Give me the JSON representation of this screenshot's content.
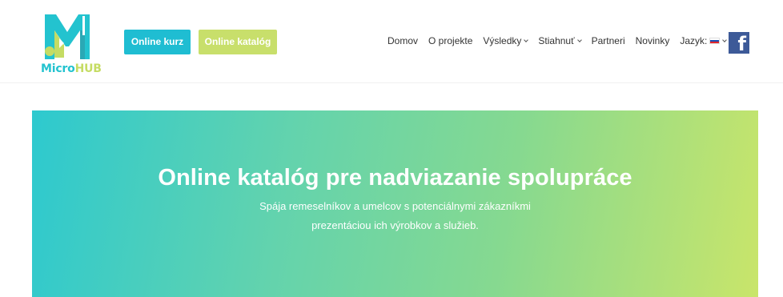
{
  "brand": {
    "logo_micro": "Micro",
    "logo_hub": "HUB",
    "colors": {
      "teal": "#1fbdd2",
      "lime": "#c8df6b",
      "facebook": "#3d5a98"
    }
  },
  "header": {
    "buttons": {
      "online_kurz": "Online kurz",
      "online_katalog": "Online katalóg"
    },
    "nav": [
      {
        "label": "Domov"
      },
      {
        "label": "O projekte"
      },
      {
        "label": "Výsledky"
      },
      {
        "label": "Stiahnuť"
      },
      {
        "label": "Partneri"
      },
      {
        "label": "Novinky"
      },
      {
        "label": "Jazyk:"
      }
    ],
    "facebook_icon": "facebook-icon",
    "facebook_glyph": "f"
  },
  "hero": {
    "title": "Online katalóg pre nadviazanie spolupráce",
    "subtitle_line1": "Spája remeselníkov a umelcov s potenciálnymi zákazníkmi",
    "subtitle_line2": "prezentáciou ich výrobkov a služieb."
  }
}
